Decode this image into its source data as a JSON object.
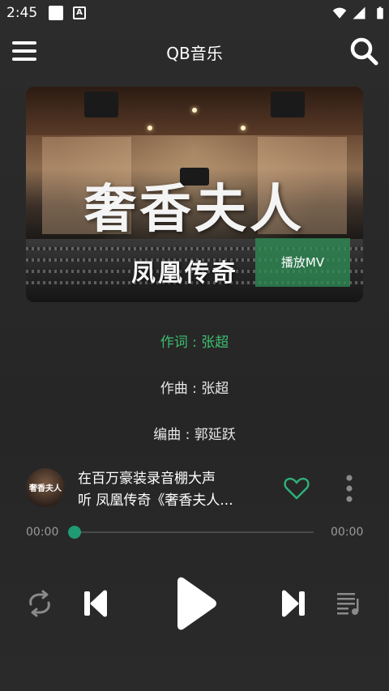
{
  "status_bar": {
    "time": "2:45",
    "icons": [
      "notification-square-icon",
      "accessibility-a-icon",
      "wifi-icon",
      "signal-icon",
      "battery-icon"
    ],
    "a_badge": "A"
  },
  "app_bar": {
    "title": "QB音乐",
    "icons": [
      "menu-icon",
      "search-icon"
    ]
  },
  "cover": {
    "title": "奢香夫人",
    "subtitle": "凤凰传奇",
    "mv_button": "播放MV",
    "mv_button_color": "#2e8c54"
  },
  "lyrics": {
    "line1": "作词 : 张超",
    "line2": "作曲 : 张超",
    "line3": "编曲 : 郭延跃",
    "active_color": "#3dbf6e"
  },
  "now_playing": {
    "thumb_text": "奢香夫人",
    "title_line1": "在百万豪装录音棚大声",
    "title_line2": "听 凤凰传奇《奢香夫人...",
    "liked": false
  },
  "progress": {
    "current": "00:00",
    "total": "00:00",
    "fraction": 0.0,
    "accent": "#1f9b74"
  },
  "controls": {
    "icons": [
      "repeat-icon",
      "previous-icon",
      "play-icon",
      "next-icon",
      "playlist-icon"
    ]
  }
}
